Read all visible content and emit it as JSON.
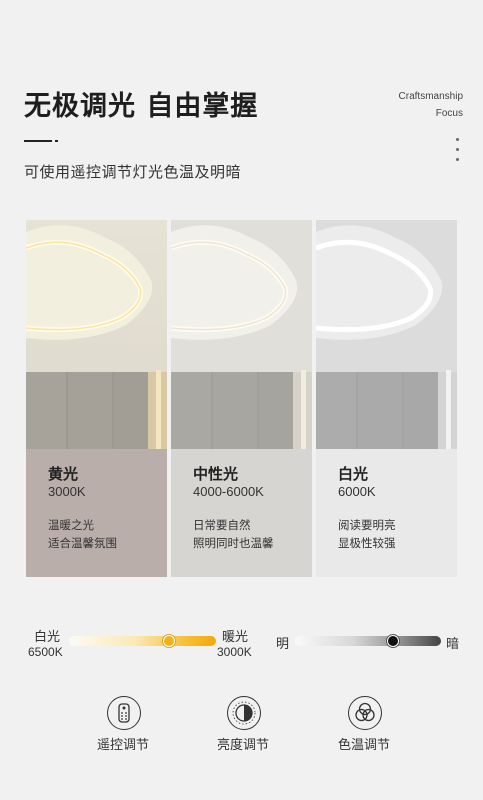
{
  "header": {
    "title": "无极调光  自由掌握",
    "tag_line1": "Craftsmanship",
    "tag_line2": "Focus",
    "subtitle": "可使用遥控调节灯光色温及明暗"
  },
  "panels": [
    {
      "name": "黄光",
      "temp": "3000K",
      "desc1": "温暖之光",
      "desc2": "适合温馨氛围",
      "tone": "warm",
      "color": "#b9aea9"
    },
    {
      "name": "中性光",
      "temp": "4000-6000K",
      "desc1": "日常要自然",
      "desc2": "照明同时也温馨",
      "tone": "neutral",
      "color": "#d7d5d2"
    },
    {
      "name": "白光",
      "temp": "6000K",
      "desc1": "阅读要明亮",
      "desc2": "显极性较强",
      "tone": "cool",
      "color": "#e9e9e9"
    }
  ],
  "scales": {
    "temperature": {
      "left_label": "白光",
      "left_value": "6500K",
      "right_label": "暖光",
      "right_value": "3000K",
      "position": 0.68
    },
    "brightness": {
      "left_label": "明",
      "right_label": "暗",
      "position": 0.67
    }
  },
  "features": [
    {
      "label": "遥控调节",
      "icon": "remote-control-icon"
    },
    {
      "label": "亮度调节",
      "icon": "brightness-icon"
    },
    {
      "label": "色温调节",
      "icon": "color-temperature-icon"
    }
  ]
}
